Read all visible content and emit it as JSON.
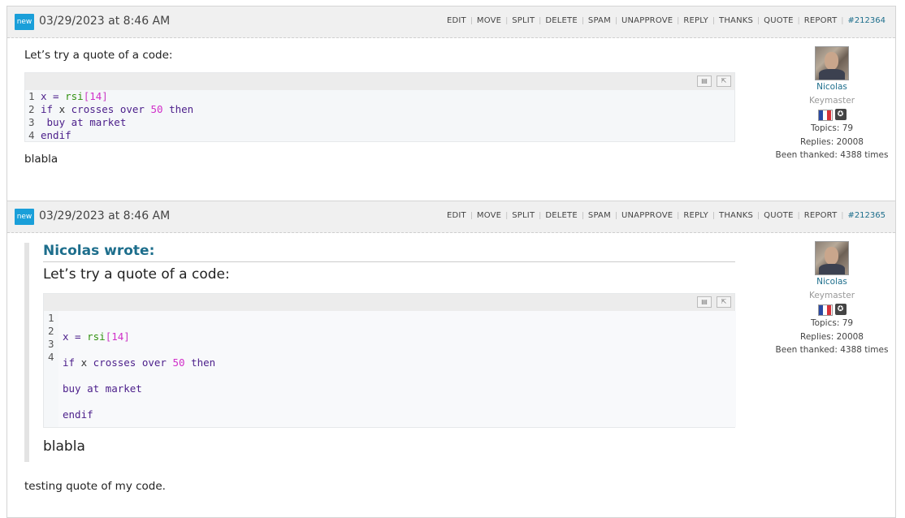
{
  "actions": [
    "EDIT",
    "MOVE",
    "SPLIT",
    "DELETE",
    "SPAM",
    "UNAPPROVE",
    "REPLY",
    "THANKS",
    "QUOTE",
    "REPORT"
  ],
  "posts": [
    {
      "badge": "new",
      "date": "03/29/2023 at 8:46 AM",
      "post_id": "#212364",
      "intro": "Let’s try a quote of a code:",
      "outro": "blabla"
    },
    {
      "badge": "new",
      "date": "03/29/2023 at 8:46 AM",
      "post_id": "#212365",
      "quote_title": "Nicolas wrote:",
      "quote_intro": "Let’s try a quote of a code:",
      "quote_outro": "blabla",
      "outro": "testing quote of my code."
    }
  ],
  "code": {
    "line_numbers": [
      "1",
      "2",
      "3",
      "4"
    ],
    "lines": [
      {
        "tokens": [
          "x = ",
          "rsi",
          "[",
          "14",
          "]"
        ]
      },
      {
        "tokens": [
          "if",
          " x ",
          "crosses over",
          " ",
          "50",
          " ",
          "then"
        ]
      },
      {
        "tokens": [
          " buy at market"
        ]
      },
      {
        "tokens": [
          "endif"
        ]
      }
    ]
  },
  "author": {
    "name": "Nicolas",
    "role": "Keymaster",
    "topics": "Topics: 79",
    "replies": "Replies: 20008",
    "thanked": "Been thanked: 4388 times"
  },
  "icons": {
    "copy": "copy-icon",
    "popout": "popout-icon",
    "avatar": "avatar-image",
    "flag": "france-flag-icon",
    "rank": "rank-badge-icon"
  },
  "colors": {
    "badge": "#1a9fd9",
    "link": "#1d6e8c",
    "keyword": "#4b1e8a",
    "function": "#31910f",
    "number": "#d12fc9"
  }
}
